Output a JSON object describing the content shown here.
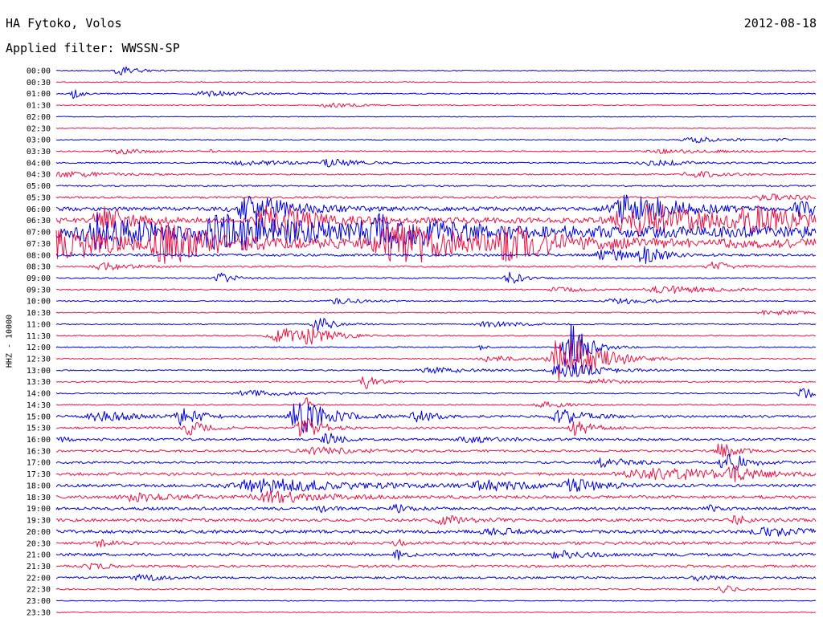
{
  "header": {
    "station": "HA Fytoko, Volos",
    "filter": "Applied filter: WWSSN-SP",
    "date": "2012-08-18"
  },
  "chart_data": {
    "type": "helicorder",
    "ylabel": "HHZ - 10000",
    "colors": {
      "a": "#0000dd",
      "b": "#ee1144"
    },
    "rows": [
      {
        "time": "00:00",
        "amp": 0.5,
        "events": [
          {
            "x": 0.09,
            "a": 5,
            "d": 0.02
          }
        ]
      },
      {
        "time": "00:30",
        "amp": 0.6,
        "events": []
      },
      {
        "time": "01:00",
        "amp": 0.7,
        "events": [
          {
            "x": 0.025,
            "a": 7,
            "d": 0.008
          },
          {
            "x": 0.21,
            "a": 3,
            "d": 0.04
          }
        ]
      },
      {
        "time": "01:30",
        "amp": 0.6,
        "events": [
          {
            "x": 0.37,
            "a": 3,
            "d": 0.03
          }
        ]
      },
      {
        "time": "02:00",
        "amp": 0.5,
        "events": []
      },
      {
        "time": "02:30",
        "amp": 0.5,
        "events": []
      },
      {
        "time": "03:00",
        "amp": 0.6,
        "events": [
          {
            "x": 0.85,
            "a": 3,
            "d": 0.04
          },
          {
            "x": 0.95,
            "a": 5,
            "d": 0.005
          }
        ]
      },
      {
        "time": "03:30",
        "amp": 0.7,
        "events": [
          {
            "x": 0.09,
            "a": 3,
            "d": 0.03
          },
          {
            "x": 0.2,
            "a": 4,
            "d": 0.005
          },
          {
            "x": 0.82,
            "a": 2.5,
            "d": 0.06
          }
        ]
      },
      {
        "time": "04:00",
        "amp": 0.8,
        "events": [
          {
            "x": 0.27,
            "a": 2.5,
            "d": 0.06
          },
          {
            "x": 0.37,
            "a": 4,
            "d": 0.03
          },
          {
            "x": 0.8,
            "a": 3,
            "d": 0.05
          }
        ]
      },
      {
        "time": "04:30",
        "amp": 0.8,
        "events": [
          {
            "x": 0.03,
            "a": 3,
            "d": 0.05
          },
          {
            "x": 0.85,
            "a": 3,
            "d": 0.04
          }
        ]
      },
      {
        "time": "05:00",
        "amp": 0.9,
        "events": []
      },
      {
        "time": "05:30",
        "amp": 1.2,
        "events": [
          {
            "x": 0.95,
            "a": 3,
            "d": 0.05
          }
        ]
      },
      {
        "time": "06:00",
        "amp": 2.5,
        "events": [
          {
            "x": 0.27,
            "a": 14,
            "d": 0.05
          },
          {
            "x": 0.77,
            "a": 16,
            "d": 0.06
          },
          {
            "x": 0.98,
            "a": 14,
            "d": 0.015
          }
        ]
      },
      {
        "time": "06:30",
        "amp": 3.5,
        "events": [
          {
            "x": 0.07,
            "a": 14,
            "d": 0.03
          },
          {
            "x": 0.3,
            "a": 16,
            "d": 0.05
          },
          {
            "x": 0.79,
            "a": 18,
            "d": 0.08
          },
          {
            "x": 0.93,
            "a": 12,
            "d": 0.05
          }
        ]
      },
      {
        "time": "07:00",
        "amp": 7,
        "events": [
          {
            "x": 0.07,
            "a": 16,
            "d": 0.05
          },
          {
            "x": 0.25,
            "a": 15,
            "d": 0.1
          },
          {
            "x": 0.45,
            "a": 14,
            "d": 0.07
          }
        ]
      },
      {
        "time": "07:30",
        "amp": 6,
        "events": [
          {
            "x": 0.02,
            "a": 16,
            "d": 0.05
          },
          {
            "x": 0.16,
            "a": 18,
            "d": 0.05
          },
          {
            "x": 0.47,
            "a": 20,
            "d": 0.07
          },
          {
            "x": 0.61,
            "a": 13,
            "d": 0.05
          }
        ]
      },
      {
        "time": "08:00",
        "amp": 1.5,
        "events": [
          {
            "x": 0.73,
            "a": 7,
            "d": 0.03
          },
          {
            "x": 0.78,
            "a": 9,
            "d": 0.02
          }
        ]
      },
      {
        "time": "08:30",
        "amp": 1,
        "events": [
          {
            "x": 0.07,
            "a": 4,
            "d": 0.03
          },
          {
            "x": 0.87,
            "a": 5,
            "d": 0.02
          }
        ]
      },
      {
        "time": "09:00",
        "amp": 0.8,
        "events": [
          {
            "x": 0.22,
            "a": 6,
            "d": 0.015
          },
          {
            "x": 0.6,
            "a": 7,
            "d": 0.015
          }
        ]
      },
      {
        "time": "09:30",
        "amp": 0.8,
        "events": [
          {
            "x": 0.67,
            "a": 3,
            "d": 0.03
          },
          {
            "x": 0.82,
            "a": 4,
            "d": 0.06
          }
        ]
      },
      {
        "time": "10:00",
        "amp": 0.7,
        "events": [
          {
            "x": 0.38,
            "a": 3,
            "d": 0.03
          },
          {
            "x": 0.75,
            "a": 3,
            "d": 0.04
          }
        ]
      },
      {
        "time": "10:30",
        "amp": 0.6,
        "events": [
          {
            "x": 0.95,
            "a": 3,
            "d": 0.04
          }
        ]
      },
      {
        "time": "11:00",
        "amp": 0.7,
        "events": [
          {
            "x": 0.35,
            "a": 8,
            "d": 0.02
          },
          {
            "x": 0.58,
            "a": 3,
            "d": 0.04
          }
        ]
      },
      {
        "time": "11:30",
        "amp": 0.7,
        "events": [
          {
            "x": 0.3,
            "a": 9,
            "d": 0.03
          },
          {
            "x": 0.34,
            "a": 8,
            "d": 0.03
          }
        ]
      },
      {
        "time": "12:00",
        "amp": 0.7,
        "events": [
          {
            "x": 0.56,
            "a": 4,
            "d": 0.005
          },
          {
            "x": 0.68,
            "a": 30,
            "d": 0.02
          }
        ]
      },
      {
        "time": "12:30",
        "amp": 0.7,
        "events": [
          {
            "x": 0.68,
            "a": 32,
            "d": 0.04
          },
          {
            "x": 0.58,
            "a": 3,
            "d": 0.04
          }
        ]
      },
      {
        "time": "13:00",
        "amp": 0.8,
        "events": [
          {
            "x": 0.51,
            "a": 3,
            "d": 0.05
          },
          {
            "x": 0.68,
            "a": 10,
            "d": 0.04
          }
        ]
      },
      {
        "time": "13:30",
        "amp": 0.8,
        "events": [
          {
            "x": 0.41,
            "a": 8,
            "d": 0.015
          },
          {
            "x": 0.72,
            "a": 3,
            "d": 0.03
          }
        ]
      },
      {
        "time": "14:00",
        "amp": 0.7,
        "events": [
          {
            "x": 0.27,
            "a": 3,
            "d": 0.05
          },
          {
            "x": 0.99,
            "a": 7,
            "d": 0.02
          }
        ]
      },
      {
        "time": "14:30",
        "amp": 0.7,
        "events": [
          {
            "x": 0.33,
            "a": 10,
            "d": 0.006
          },
          {
            "x": 0.65,
            "a": 3,
            "d": 0.03
          }
        ]
      },
      {
        "time": "15:00",
        "amp": 1.5,
        "events": [
          {
            "x": 0.07,
            "a": 5,
            "d": 0.04
          },
          {
            "x": 0.17,
            "a": 11,
            "d": 0.02
          },
          {
            "x": 0.33,
            "a": 22,
            "d": 0.03
          },
          {
            "x": 0.48,
            "a": 6,
            "d": 0.02
          },
          {
            "x": 0.67,
            "a": 10,
            "d": 0.025
          }
        ]
      },
      {
        "time": "15:30",
        "amp": 1.2,
        "events": [
          {
            "x": 0.18,
            "a": 8,
            "d": 0.02
          },
          {
            "x": 0.33,
            "a": 14,
            "d": 0.02
          },
          {
            "x": 0.69,
            "a": 9,
            "d": 0.02
          }
        ]
      },
      {
        "time": "16:00",
        "amp": 1.5,
        "events": [
          {
            "x": 0.0,
            "a": 6,
            "d": 0.01
          },
          {
            "x": 0.36,
            "a": 7,
            "d": 0.015
          },
          {
            "x": 0.55,
            "a": 4,
            "d": 0.03
          }
        ]
      },
      {
        "time": "16:30",
        "amp": 1.3,
        "events": [
          {
            "x": 0.35,
            "a": 4,
            "d": 0.05
          },
          {
            "x": 0.88,
            "a": 8,
            "d": 0.02
          }
        ]
      },
      {
        "time": "17:00",
        "amp": 1.3,
        "events": [
          {
            "x": 0.73,
            "a": 5,
            "d": 0.03
          },
          {
            "x": 0.89,
            "a": 10,
            "d": 0.025
          }
        ]
      },
      {
        "time": "17:30",
        "amp": 1.8,
        "events": [
          {
            "x": 0.82,
            "a": 6,
            "d": 0.1
          },
          {
            "x": 0.89,
            "a": 7,
            "d": 0.02
          }
        ]
      },
      {
        "time": "18:00",
        "amp": 1.8,
        "events": [
          {
            "x": 0.3,
            "a": 7,
            "d": 0.1
          },
          {
            "x": 0.58,
            "a": 5,
            "d": 0.05
          },
          {
            "x": 0.69,
            "a": 7,
            "d": 0.03
          }
        ]
      },
      {
        "time": "18:30",
        "amp": 1.8,
        "events": [
          {
            "x": 0.12,
            "a": 4,
            "d": 0.05
          },
          {
            "x": 0.3,
            "a": 6,
            "d": 0.06
          }
        ]
      },
      {
        "time": "19:00",
        "amp": 1.8,
        "events": [
          {
            "x": 0.35,
            "a": 5,
            "d": 0.01
          },
          {
            "x": 0.45,
            "a": 4,
            "d": 0.02
          },
          {
            "x": 0.86,
            "a": 5,
            "d": 0.01
          }
        ]
      },
      {
        "time": "19:30",
        "amp": 1.8,
        "events": [
          {
            "x": 0.52,
            "a": 4,
            "d": 0.03
          },
          {
            "x": 0.9,
            "a": 4,
            "d": 0.02
          }
        ]
      },
      {
        "time": "20:00",
        "amp": 2,
        "events": [
          {
            "x": 0.58,
            "a": 4,
            "d": 0.03
          },
          {
            "x": 0.95,
            "a": 4,
            "d": 0.05
          }
        ]
      },
      {
        "time": "20:30",
        "amp": 1.8,
        "events": [
          {
            "x": 0.06,
            "a": 5,
            "d": 0.01
          },
          {
            "x": 0.45,
            "a": 4,
            "d": 0.01
          }
        ]
      },
      {
        "time": "21:00",
        "amp": 1.8,
        "events": [
          {
            "x": 0.45,
            "a": 5,
            "d": 0.01
          },
          {
            "x": 0.67,
            "a": 4,
            "d": 0.03
          }
        ]
      },
      {
        "time": "21:30",
        "amp": 1.5,
        "events": [
          {
            "x": 0.05,
            "a": 3,
            "d": 0.02
          }
        ]
      },
      {
        "time": "22:00",
        "amp": 1.3,
        "events": [
          {
            "x": 0.12,
            "a": 3,
            "d": 0.03
          },
          {
            "x": 0.85,
            "a": 3,
            "d": 0.02
          }
        ]
      },
      {
        "time": "22:30",
        "amp": 0.8,
        "events": [
          {
            "x": 0.88,
            "a": 5,
            "d": 0.015
          }
        ]
      },
      {
        "time": "23:00",
        "amp": 0.5,
        "events": []
      },
      {
        "time": "23:30",
        "amp": 0.5,
        "events": []
      }
    ]
  }
}
